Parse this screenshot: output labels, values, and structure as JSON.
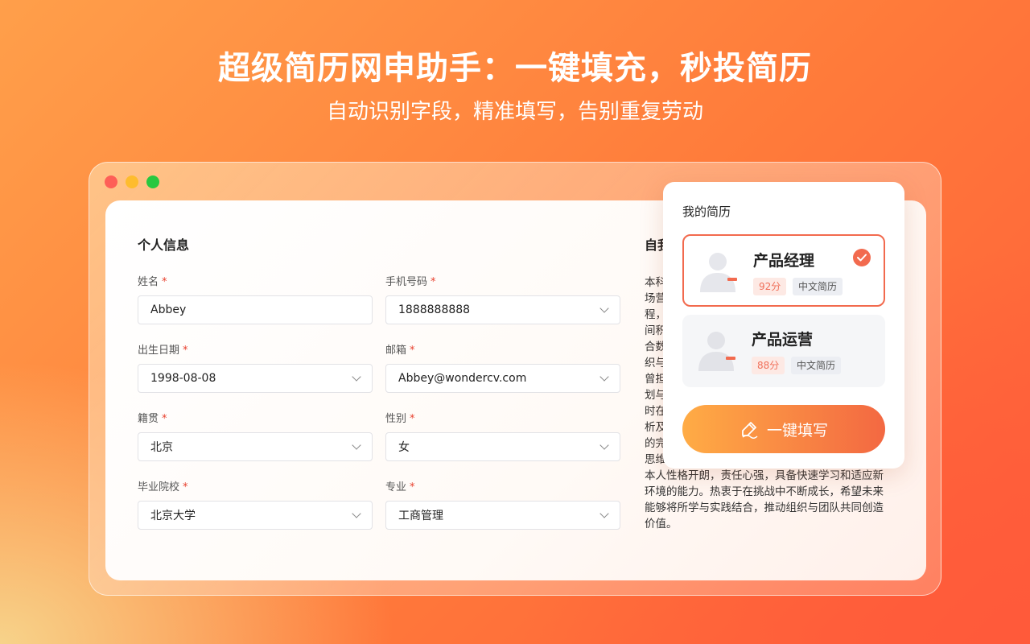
{
  "hero": {
    "title": "超级简历网申助手：一键填充，秒投简历",
    "subtitle": "自动识别字段，精准填写，告别重复劳动"
  },
  "form": {
    "section_title": "个人信息",
    "fields": [
      {
        "label": "姓名",
        "value": "Abbey",
        "has_dropdown": false
      },
      {
        "label": "手机号码",
        "value": "1888888888",
        "has_dropdown": true
      },
      {
        "label": "出生日期",
        "value": "1998-08-08",
        "has_dropdown": true
      },
      {
        "label": "邮箱",
        "value": "Abbey@wondercv.com",
        "has_dropdown": true
      },
      {
        "label": "籍贯",
        "value": "北京",
        "has_dropdown": true
      },
      {
        "label": "性别",
        "value": "女",
        "has_dropdown": true
      },
      {
        "label": "毕业院校",
        "value": "北京大学",
        "has_dropdown": true
      },
      {
        "label": "专业",
        "value": "工商管理",
        "has_dropdown": true
      }
    ],
    "required_mark": "*"
  },
  "intro": {
    "title": "自我",
    "partial_lines": [
      "本科",
      "场营",
      "程，",
      "间积",
      "合数",
      "织与",
      "曾担",
      "划与",
      "时在",
      "析及",
      "的完",
      "思维"
    ],
    "full_lines": [
      "本人性格开朗，责任心强，具备快速学习和适应新",
      "环境的能力。热衷于在挑战中不断成长，希望未来",
      "能够将所学与实践结合，推动组织与团队共同创造",
      "价值。"
    ]
  },
  "popup": {
    "title": "我的简历",
    "resumes": [
      {
        "name": "产品经理",
        "score": "92分",
        "lang": "中文简历",
        "selected": true
      },
      {
        "name": "产品运营",
        "score": "88分",
        "lang": "中文简历",
        "selected": false
      }
    ],
    "fill_button": "一键填写"
  },
  "colors": {
    "accent": "#f26a4e",
    "required": "#e8402e",
    "button_start": "#ffac45",
    "button_end": "#f36842"
  },
  "icons": [
    "chevron-down-icon",
    "check-icon",
    "avatar-icon",
    "pen-icon"
  ]
}
